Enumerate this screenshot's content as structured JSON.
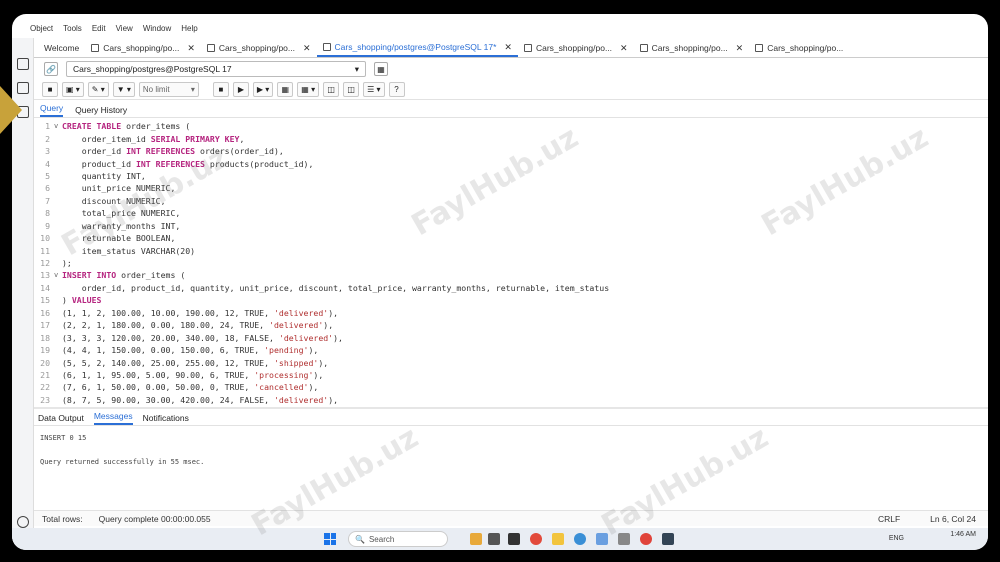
{
  "menu": [
    "Object",
    "Tools",
    "Edit",
    "View",
    "Window",
    "Help"
  ],
  "tabs": [
    {
      "label": "Welcome",
      "icon": false,
      "close": false,
      "active": false
    },
    {
      "label": "Cars_shopping/po...",
      "icon": true,
      "close": true,
      "active": false
    },
    {
      "label": "Cars_shopping/po...",
      "icon": true,
      "close": true,
      "active": false
    },
    {
      "label": "Cars_shopping/postgres@PostgreSQL 17*",
      "icon": true,
      "close": true,
      "active": true
    },
    {
      "label": "Cars_shopping/po...",
      "icon": true,
      "close": true,
      "active": false
    },
    {
      "label": "Cars_shopping/po...",
      "icon": true,
      "close": true,
      "active": false
    },
    {
      "label": "Cars_shopping/po...",
      "icon": true,
      "close": false,
      "active": false
    }
  ],
  "connection": {
    "value": "Cars_shopping/postgres@PostgreSQL 17"
  },
  "toolbar": {
    "limit_value": "No limit"
  },
  "query_tabs": {
    "query": "Query",
    "history": "Query History"
  },
  "editor_lines": [
    {
      "n": "1",
      "fold": "v",
      "html": "<span class='kw'>CREATE TABLE</span> order_items ("
    },
    {
      "n": "2",
      "fold": "",
      "html": "    order_item_id <span class='kw'>SERIAL PRIMARY KEY</span>,"
    },
    {
      "n": "3",
      "fold": "",
      "html": "    order_id <span class='kw'>INT REFERENCES</span> orders(order_id),"
    },
    {
      "n": "4",
      "fold": "",
      "html": "    product_id <span class='kw'>INT REFERENCES</span> products(product_id),"
    },
    {
      "n": "5",
      "fold": "",
      "html": "    quantity INT,"
    },
    {
      "n": "6",
      "fold": "",
      "html": "    unit_price NUMERIC,"
    },
    {
      "n": "7",
      "fold": "",
      "html": "    discount NUMERIC,"
    },
    {
      "n": "8",
      "fold": "",
      "html": "    total_price NUMERIC,"
    },
    {
      "n": "9",
      "fold": "",
      "html": "    warranty_months INT,"
    },
    {
      "n": "10",
      "fold": "",
      "html": "    returnable BOOLEAN,"
    },
    {
      "n": "11",
      "fold": "",
      "html": "    item_status VARCHAR(20)"
    },
    {
      "n": "12",
      "fold": "",
      "html": ");"
    },
    {
      "n": "13",
      "fold": "v",
      "html": "<span class='kw'>INSERT INTO</span> order_items ("
    },
    {
      "n": "14",
      "fold": "",
      "html": "    order_id, product_id, quantity, unit_price, discount, total_price, warranty_months, returnable, item_status"
    },
    {
      "n": "15",
      "fold": "",
      "html": ") <span class='kw'>VALUES</span>"
    },
    {
      "n": "16",
      "fold": "",
      "html": "(1, 1, 2, 100.00, 10.00, 190.00, 12, TRUE, <span class='str'>'delivered'</span>),"
    },
    {
      "n": "17",
      "fold": "",
      "html": "(2, 2, 1, 180.00, 0.00, 180.00, 24, TRUE, <span class='str'>'delivered'</span>),"
    },
    {
      "n": "18",
      "fold": "",
      "html": "(3, 3, 3, 120.00, 20.00, 340.00, 18, FALSE, <span class='str'>'delivered'</span>),"
    },
    {
      "n": "19",
      "fold": "",
      "html": "(4, 4, 1, 150.00, 0.00, 150.00, 6, TRUE, <span class='str'>'pending'</span>),"
    },
    {
      "n": "20",
      "fold": "",
      "html": "(5, 5, 2, 140.00, 25.00, 255.00, 12, TRUE, <span class='str'>'shipped'</span>),"
    },
    {
      "n": "21",
      "fold": "",
      "html": "(6, 1, 1, 95.00, 5.00, 90.00, 6, TRUE, <span class='str'>'processing'</span>),"
    },
    {
      "n": "22",
      "fold": "",
      "html": "(7, 6, 1, 50.00, 0.00, 50.00, 0, TRUE, <span class='str'>'cancelled'</span>),"
    },
    {
      "n": "23",
      "fold": "",
      "html": "(8, 7, 5, 90.00, 30.00, 420.00, 24, FALSE, <span class='str'>'delivered'</span>),"
    }
  ],
  "output_tabs": {
    "data": "Data Output",
    "messages": "Messages",
    "notifications": "Notifications"
  },
  "messages": {
    "line1": "INSERT 0 15",
    "line2": "Query returned successfully in 55 msec."
  },
  "status": {
    "total_rows": "Total rows:",
    "complete": "Query complete 00:00:00.055",
    "eol": "CRLF",
    "cursor": "Ln 6, Col 24"
  },
  "taskbar": {
    "search_placeholder": "Search",
    "time": "1:46 AM",
    "lang": "ENG"
  },
  "watermark": "FaylHub.uz",
  "colors": {
    "accent": "#2b6fd6",
    "keyword": "#b5247f",
    "string": "#b03030"
  }
}
